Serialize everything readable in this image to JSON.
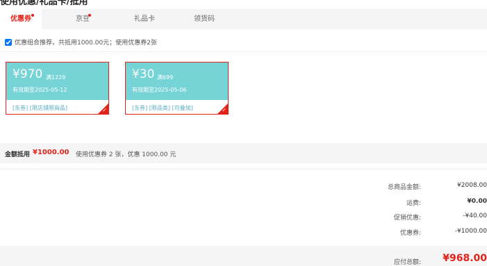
{
  "page": {
    "title": "使用优惠/礼品卡/抵用"
  },
  "tabs": [
    {
      "label": "优惠券",
      "active": true,
      "dot": true
    },
    {
      "label": "京豆",
      "active": false,
      "dot": true
    },
    {
      "label": "礼品卡",
      "active": false,
      "dot": false
    },
    {
      "label": "领货码",
      "active": false,
      "dot": false
    }
  ],
  "combo": {
    "checked": true,
    "text": "优惠组合推荐，共抵用1000.00元；使用优惠券2张"
  },
  "coupons": [
    {
      "amount": "¥970",
      "condition": "满1229",
      "valid": "有效期至2025-05-12",
      "tags": "[东券]  [限店铺限商品]",
      "selected": true
    },
    {
      "amount": "¥30",
      "condition": "满699",
      "valid": "有效期至2025-05-06",
      "tags": "[东券]  [限品类]  [可叠加]",
      "selected": true
    }
  ],
  "summary": {
    "label": "金额抵用",
    "value": "¥1000.00",
    "desc": "使用优惠券 2 张，优惠 1000.00 元"
  },
  "totals": [
    {
      "label": "总商品金额:",
      "value": "¥2008.00"
    },
    {
      "label": "运费:",
      "value": "¥0.00"
    },
    {
      "label": "促销优惠:",
      "value": "-¥40.00"
    },
    {
      "label": "优惠券:",
      "value": "-¥1000.00"
    }
  ],
  "payable": {
    "label": "应付总额:",
    "value": "¥968.00"
  }
}
